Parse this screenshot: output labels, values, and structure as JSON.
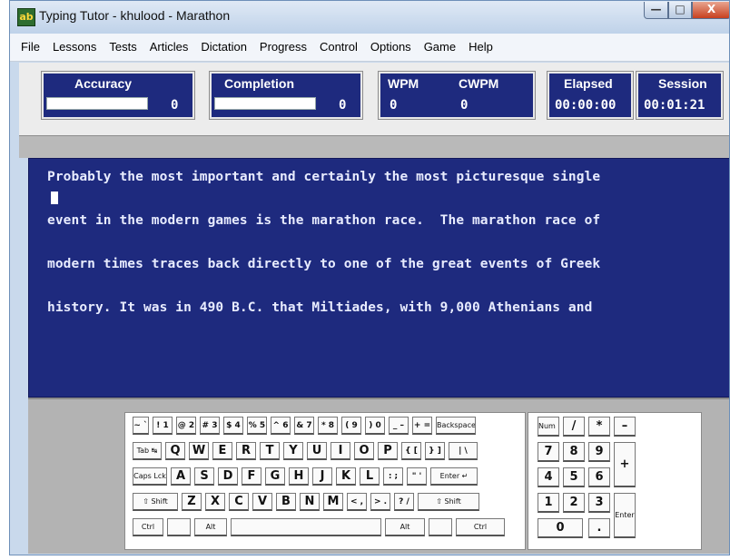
{
  "window": {
    "title": "Typing Tutor - khulood - Marathon",
    "icon": "typing-tutor-app-icon"
  },
  "title_buttons": {
    "minimize": "—",
    "maximize": "□",
    "close": "X"
  },
  "menu": [
    "File",
    "Lessons",
    "Tests",
    "Articles",
    "Dictation",
    "Progress",
    "Control",
    "Options",
    "Game",
    "Help"
  ],
  "stats": {
    "accuracy": {
      "label": "Accuracy",
      "value": "0",
      "progress_fraction": 0
    },
    "completion": {
      "label": "Completion",
      "value": "0",
      "progress_fraction": 0
    },
    "wpm": {
      "label": "WPM",
      "value": "0"
    },
    "cwpm": {
      "label": "CWPM",
      "value": "0"
    },
    "elapsed": {
      "label": "Elapsed",
      "value": "00:00:00"
    },
    "session": {
      "label": "Session",
      "value": "00:01:21"
    }
  },
  "text_lines": [
    "Probably the most important and certainly the most picturesque single",
    "event in the modern games is the marathon race.  The marathon race of",
    "modern times traces back directly to one of the great events of Greek",
    "history. It was in 490 B.C. that Miltiades, with 9,000 Athenians and"
  ],
  "keyboard": {
    "row1": [
      "~ `",
      "! 1",
      "@ 2",
      "# 3",
      "$ 4",
      "% 5",
      "^ 6",
      "& 7",
      "* 8",
      "( 9",
      ") 0",
      "_ –",
      "+ =",
      "Backspace"
    ],
    "row2": [
      "Tab ↹",
      "Q",
      "W",
      "E",
      "R",
      "T",
      "Y",
      "U",
      "I",
      "O",
      "P",
      "{ [",
      "} ]",
      "| \\"
    ],
    "row3": [
      "Caps Lck",
      "A",
      "S",
      "D",
      "F",
      "G",
      "H",
      "J",
      "K",
      "L",
      ": ;",
      "\" '",
      "Enter ↵"
    ],
    "row4": [
      "⇧ Shift",
      "Z",
      "X",
      "C",
      "V",
      "B",
      "N",
      "M",
      "< ,",
      "> .",
      "? /",
      "⇧ Shift"
    ],
    "row5": [
      "Ctrl",
      "",
      "Alt",
      "",
      "Alt",
      "",
      "Ctrl"
    ]
  },
  "numpad": {
    "row1": [
      "Num Lock",
      "/",
      "*",
      "–"
    ],
    "row2": [
      "7",
      "8",
      "9",
      "+"
    ],
    "row3": [
      "4",
      "5",
      "6"
    ],
    "row4": [
      "1",
      "2",
      "3",
      "Enter"
    ],
    "row5": [
      "0",
      "."
    ]
  }
}
